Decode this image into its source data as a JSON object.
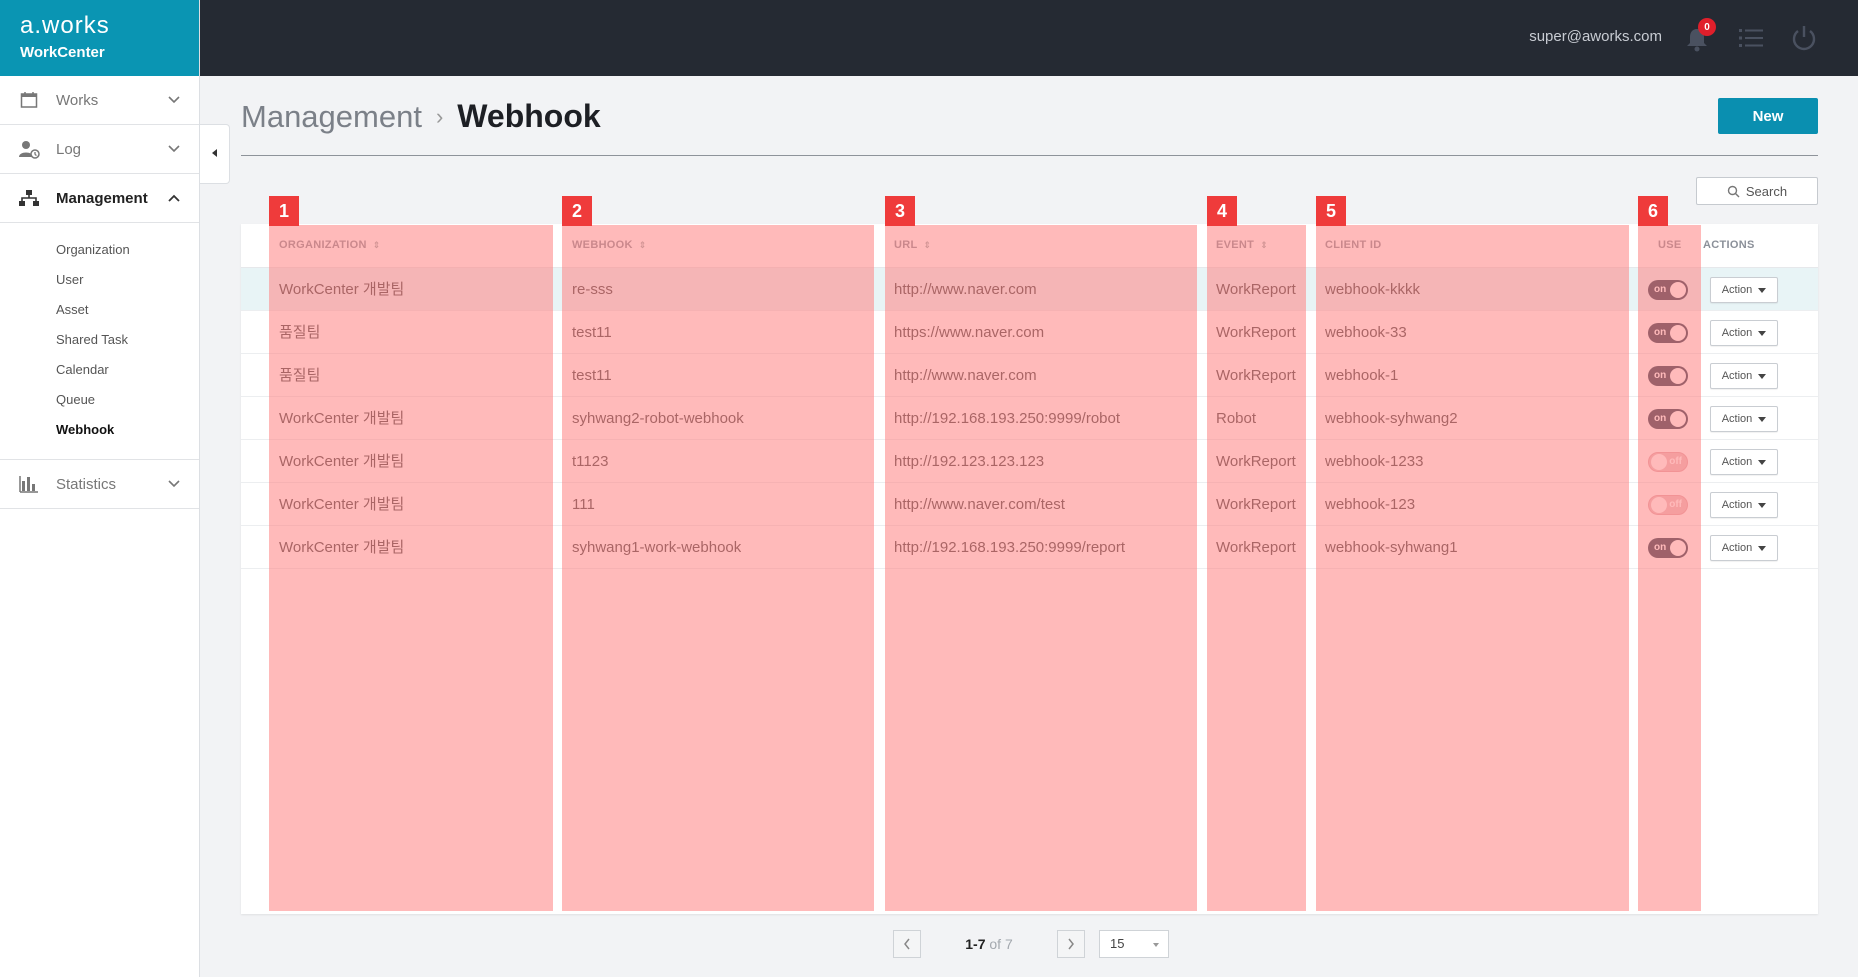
{
  "brand": {
    "logo": "a.works",
    "name": "WorkCenter"
  },
  "topbar": {
    "email": "super@aworks.com",
    "notification_count": "0"
  },
  "sidebar": {
    "items": [
      {
        "label": "Works",
        "icon": "calendar-icon"
      },
      {
        "label": "Log",
        "icon": "user-log-icon"
      },
      {
        "label": "Management",
        "icon": "sitemap-icon"
      },
      {
        "label": "Statistics",
        "icon": "bar-chart-icon"
      }
    ],
    "submenu": [
      "Organization",
      "User",
      "Asset",
      "Shared Task",
      "Calendar",
      "Queue",
      "Webhook"
    ]
  },
  "header": {
    "breadcrumb": "Management",
    "title": "Webhook",
    "new_label": "New",
    "search_label": "Search"
  },
  "table": {
    "columns": [
      "ORGANIZATION",
      "WEBHOOK",
      "URL",
      "EVENT",
      "CLIENT ID",
      "USE",
      "ACTIONS"
    ],
    "action_label": "Action",
    "rows": [
      {
        "org": "WorkCenter 개발팀",
        "webhook": "re-sss",
        "url": "http://www.naver.com",
        "event": "WorkReport",
        "client": "webhook-kkkk",
        "use": "on"
      },
      {
        "org": "품질팀",
        "webhook": "test11",
        "url": "https://www.naver.com",
        "event": "WorkReport",
        "client": "webhook-33",
        "use": "on"
      },
      {
        "org": "품질팀",
        "webhook": "test11",
        "url": "http://www.naver.com",
        "event": "WorkReport",
        "client": "webhook-1",
        "use": "on"
      },
      {
        "org": "WorkCenter 개발팀",
        "webhook": "syhwang2-robot-webhook",
        "url": "http://192.168.193.250:9999/robot",
        "event": "Robot",
        "client": "webhook-syhwang2",
        "use": "on"
      },
      {
        "org": "WorkCenter 개발팀",
        "webhook": "t1123",
        "url": "http://192.123.123.123",
        "event": "WorkReport",
        "client": "webhook-1233",
        "use": "off"
      },
      {
        "org": "WorkCenter 개발팀",
        "webhook": "111",
        "url": "http://www.naver.com/test",
        "event": "WorkReport",
        "client": "webhook-123",
        "use": "off"
      },
      {
        "org": "WorkCenter 개발팀",
        "webhook": "syhwang1-work-webhook",
        "url": "http://192.168.193.250:9999/report",
        "event": "WorkReport",
        "client": "webhook-syhwang1",
        "use": "on"
      }
    ]
  },
  "overlay_labels": [
    "1",
    "2",
    "3",
    "4",
    "5",
    "6"
  ],
  "pagination": {
    "range": "1-7",
    "of_label": "of 7",
    "page_size": "15"
  },
  "colors": {
    "brand": "#0a95b3",
    "topbar": "#252a33",
    "primary_button": "#0a8fb0",
    "overlay": "#ff8282",
    "overlay_label": "#ef3b3b"
  }
}
